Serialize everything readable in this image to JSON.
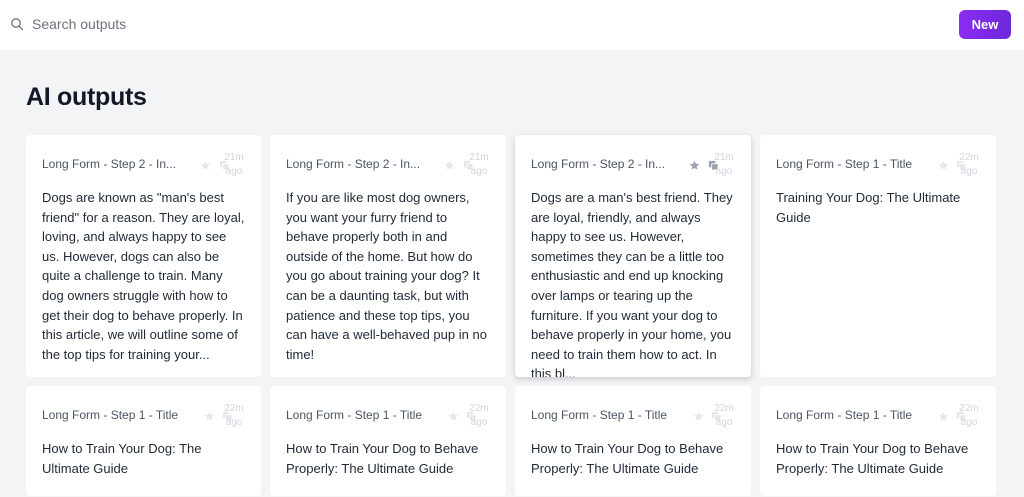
{
  "search": {
    "placeholder": "Search outputs"
  },
  "header": {
    "new_label": "New"
  },
  "page": {
    "title": "AI outputs"
  },
  "cards": [
    {
      "type": "Long Form - Step 2 - In...",
      "time": "21m ago",
      "body": "Dogs are known as \"man's best friend\" for a reason. They are loyal, loving, and always happy to see us. However, dogs can also be quite a challenge to train. Many dog owners struggle with how to get their dog to behave properly. In this article, we will outline some of the top tips for training your...",
      "active": false
    },
    {
      "type": "Long Form - Step 2 - In...",
      "time": "21m ago",
      "body": "If you are like most dog owners, you want your furry friend to behave properly both in and outside of the home. But how do you go about training your dog? It can be a daunting task, but with patience and these top tips, you can have a well-behaved pup in no time!",
      "active": false
    },
    {
      "type": "Long Form - Step 2 - In...",
      "time": "21m ago",
      "body": "Dogs are a man's best friend. They are loyal, friendly, and always happy to see us. However, sometimes they can be a little too enthusiastic and end up knocking over lamps or tearing up the furniture. If you want your dog to behave properly in your home, you need to train them how to act. In this bl...",
      "active": true
    },
    {
      "type": "Long Form - Step 1 - Title",
      "time": "22m ago",
      "body": "Training Your Dog: The Ultimate Guide",
      "active": false
    },
    {
      "type": "Long Form - Step 1 - Title",
      "time": "22m ago",
      "body": "How to Train Your Dog: The Ultimate Guide",
      "active": false
    },
    {
      "type": "Long Form - Step 1 - Title",
      "time": "22m ago",
      "body": "How to Train Your Dog to Behave Properly: The Ultimate Guide",
      "active": false
    },
    {
      "type": "Long Form - Step 1 - Title",
      "time": "22m ago",
      "body": "How to Train Your Dog to Behave Properly: The Ultimate Guide",
      "active": false
    },
    {
      "type": "Long Form - Step 1 - Title",
      "time": "22m ago",
      "body": "How to Train Your Dog to Behave Properly: The Ultimate Guide",
      "active": false
    }
  ],
  "icons": {
    "search": "search-icon",
    "star": "star-icon",
    "copy": "copy-icon"
  },
  "colors": {
    "accent": "#7c3aed",
    "background": "#f3f4f6",
    "card": "#ffffff"
  }
}
